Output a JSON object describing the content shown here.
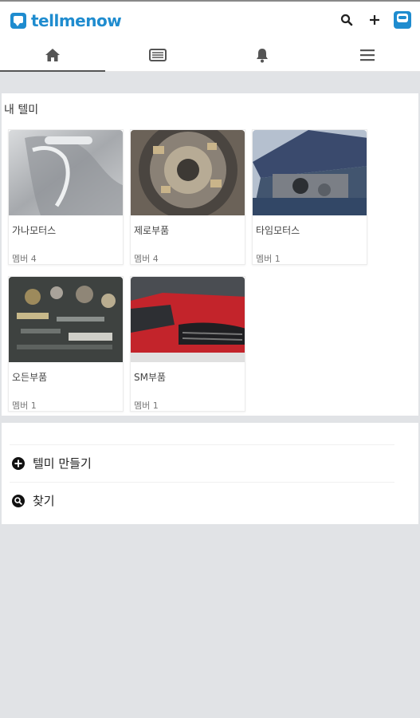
{
  "header": {
    "logo_text": "tellmenow"
  },
  "icons": {
    "search": "search-icon",
    "add": "plus-icon",
    "profile": "profile-icon",
    "home": "home-icon",
    "list": "list-icon",
    "notifications": "bell-icon",
    "menu": "hamburger-icon"
  },
  "section": {
    "title": "내 텔미"
  },
  "groups": [
    {
      "name": "가나모터스",
      "members": "멤버 4"
    },
    {
      "name": "제로부품",
      "members": "멤버 4"
    },
    {
      "name": "타임모터스",
      "members": "멤버 1"
    },
    {
      "name": "오든부품",
      "members": "멤버 1"
    },
    {
      "name": "SM부품",
      "members": "멤버 1"
    }
  ],
  "actions": {
    "create_label": "텔미 만들기",
    "find_label": "찾기"
  },
  "colors": {
    "brand": "#1f8ccf",
    "background": "#e1e3e6"
  }
}
